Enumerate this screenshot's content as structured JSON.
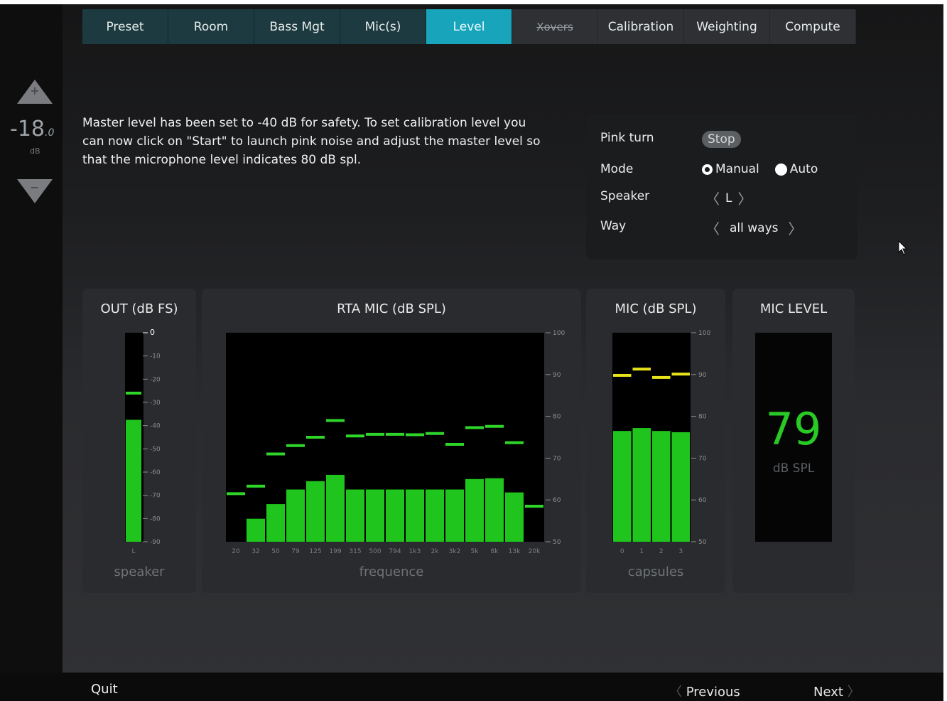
{
  "tabs": [
    {
      "label": "Preset",
      "state": "normal"
    },
    {
      "label": "Room",
      "state": "normal"
    },
    {
      "label": "Bass Mgt",
      "state": "normal"
    },
    {
      "label": "Mic(s)",
      "state": "normal"
    },
    {
      "label": "Level",
      "state": "active"
    },
    {
      "label": "Xovers",
      "state": "disabled"
    },
    {
      "label": "Calibration",
      "state": "normal"
    },
    {
      "label": "Weighting",
      "state": "normal"
    },
    {
      "label": "Compute",
      "state": "normal"
    }
  ],
  "volume": {
    "plus_label": "+",
    "minus_label": "−",
    "value": "-18",
    "value_decimal": ".0",
    "unit": "dB"
  },
  "intro_text": "Master level has been set to -40 dB for safety. To set calibration level you can now click on \"Start\" to launch pink noise and adjust the master level so that the microphone level indicates 80 dB spl.",
  "panel": {
    "pink_turn_label": "Pink turn",
    "pink_turn_button": "Stop",
    "mode_label": "Mode",
    "mode_manual": "Manual",
    "mode_auto": "Auto",
    "mode_selected": "Manual",
    "speaker_label": "Speaker",
    "speaker_value": "L",
    "way_label": "Way",
    "way_value": "all ways"
  },
  "out_meter": {
    "title": "OUT (dB FS)",
    "footer": "speaker"
  },
  "rta_meter": {
    "title": "RTA MIC (dB SPL)",
    "footer": "frequence"
  },
  "mic_meter": {
    "title": "MIC (dB SPL)",
    "footer": "capsules"
  },
  "mic_level": {
    "title": "MIC LEVEL",
    "value": "79",
    "unit": "dB SPL"
  },
  "footer": {
    "quit": "Quit",
    "previous": "Previous",
    "next": "Next"
  },
  "colors": {
    "accent": "#18a4bb",
    "tab": "#1c3a3f",
    "bar": "#1fc51d",
    "peak_green": "#2fd62a",
    "peak_yellow": "#e8e21a"
  },
  "chart_data": [
    {
      "type": "bar",
      "title": "OUT (dB FS)",
      "xlabel": "speaker",
      "categories": [
        "L"
      ],
      "values": [
        -37.5
      ],
      "peaks": [
        -26
      ],
      "ylim": [
        -90,
        0
      ],
      "yticks": [
        "0",
        "-10",
        "-20",
        "-30",
        "-40",
        "-50",
        "-60",
        "-70",
        "-80",
        "-90"
      ]
    },
    {
      "type": "bar",
      "title": "RTA MIC (dB SPL)",
      "xlabel": "frequence",
      "categories": [
        "20",
        "32",
        "50",
        "79",
        "125",
        "199",
        "315",
        "500",
        "794",
        "1k3",
        "2k",
        "3k2",
        "5k",
        "8k",
        "13k",
        "20k"
      ],
      "values": [
        50,
        55.5,
        59,
        62.5,
        64.5,
        66,
        62.5,
        62.5,
        62.5,
        62.5,
        62.5,
        62.5,
        65,
        65.2,
        61.8,
        50
      ],
      "peaks": [
        61.5,
        63.3,
        71,
        73,
        75,
        79,
        75.3,
        75.7,
        75.7,
        75.6,
        75.9,
        73.3,
        77.3,
        77.6,
        73.7,
        58.5
      ],
      "ylim": [
        50,
        100
      ],
      "yticks": [
        "100",
        "90",
        "80",
        "70",
        "60",
        "50"
      ]
    },
    {
      "type": "bar",
      "title": "MIC (dB SPL)",
      "xlabel": "capsules",
      "categories": [
        "0",
        "1",
        "2",
        "3"
      ],
      "values": [
        76.5,
        77.2,
        76.5,
        76.2
      ],
      "peaks": [
        89.8,
        91.3,
        89.3,
        90.1
      ],
      "ylim": [
        50,
        100
      ],
      "yticks": [
        "100",
        "90",
        "80",
        "70",
        "60",
        "50"
      ]
    }
  ]
}
